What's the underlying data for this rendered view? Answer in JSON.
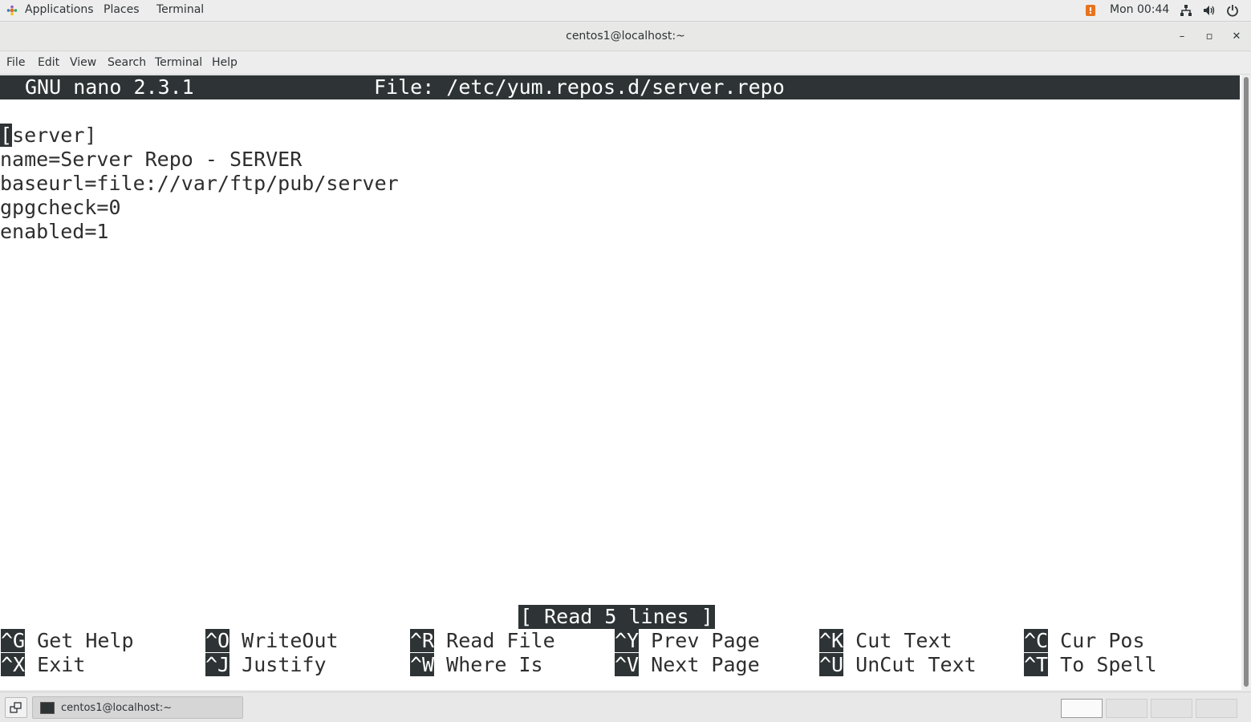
{
  "topbar": {
    "applications": "Applications",
    "places": "Places",
    "terminal": "Terminal",
    "clock": "Mon 00:44",
    "icons": [
      "applications-icon",
      "notification-icon",
      "network-icon",
      "volume-icon",
      "power-icon"
    ]
  },
  "window": {
    "title": "centos1@localhost:~",
    "minimize": "–",
    "maximize": "▫",
    "close": "✕"
  },
  "menubar": {
    "items": [
      "File",
      "Edit",
      "View",
      "Search",
      "Terminal",
      "Help"
    ]
  },
  "nano": {
    "version": "GNU nano 2.3.1",
    "file": "File: /etc/yum.repos.d/server.repo",
    "cursor_char": "[",
    "lines": [
      "server]",
      "name=Server Repo - SERVER",
      "baseurl=file://var/ftp/pub/server",
      "gpgcheck=0",
      "enabled=1"
    ],
    "status": "[ Read 5 lines ]",
    "shortcuts": [
      {
        "key": "^G",
        "label": "Get Help"
      },
      {
        "key": "^O",
        "label": "WriteOut"
      },
      {
        "key": "^R",
        "label": "Read File"
      },
      {
        "key": "^Y",
        "label": "Prev Page"
      },
      {
        "key": "^K",
        "label": "Cut Text"
      },
      {
        "key": "^C",
        "label": "Cur Pos"
      },
      {
        "key": "^X",
        "label": "Exit"
      },
      {
        "key": "^J",
        "label": "Justify"
      },
      {
        "key": "^W",
        "label": "Where Is"
      },
      {
        "key": "^V",
        "label": "Next Page"
      },
      {
        "key": "^U",
        "label": "UnCut Text"
      },
      {
        "key": "^T",
        "label": "To Spell"
      }
    ]
  },
  "taskbar": {
    "task_label": "centos1@localhost:~"
  },
  "colors": {
    "terminal_bg": "#ffffff",
    "inverse_bg": "#2e3436",
    "text": "#2e2e2e"
  }
}
